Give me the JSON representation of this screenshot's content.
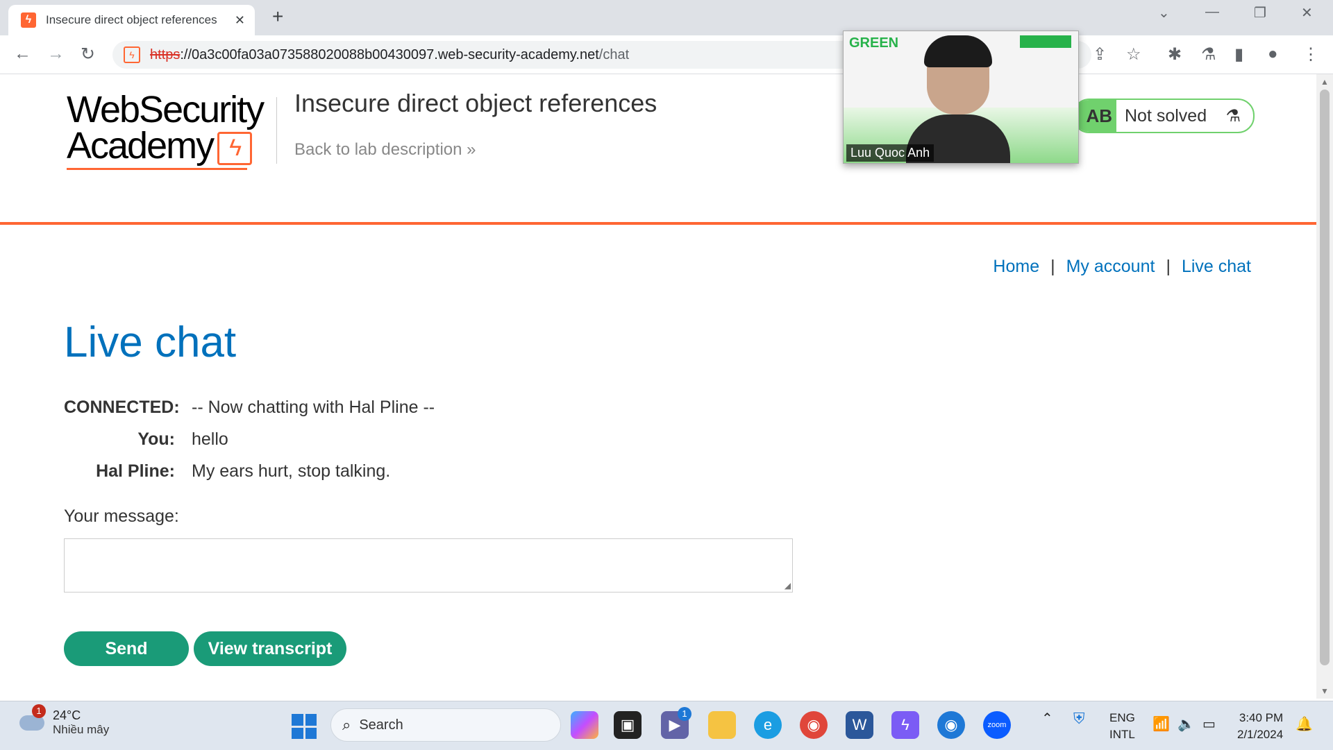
{
  "browser": {
    "tab_title": "Insecure direct object references",
    "tab_close": "✕",
    "new_tab": "+",
    "url_scheme": "https",
    "url_host": "://0a3c00fa03a073588020088b00430097.web-security-academy.net",
    "url_path": "/chat",
    "window_controls": {
      "dropdown": "⌄",
      "minimize": "—",
      "restore": "❐",
      "close": "✕"
    },
    "icons": [
      "back-icon",
      "forward-icon",
      "reload-icon",
      "share-icon",
      "star-icon",
      "extensions-icon",
      "labs-icon",
      "sidepanel-icon",
      "profile-icon",
      "menu-icon"
    ]
  },
  "header": {
    "logo_line1": "WebSecurity",
    "logo_line2": "Academy",
    "lab_title": "Insecure direct object references",
    "back_link": "Back to lab description",
    "back_chevron": "»",
    "status_prefix": "AB",
    "status_text": "Not solved"
  },
  "video": {
    "brand": "GREEN",
    "participant_name": "Luu Quoc Anh"
  },
  "nav": {
    "items": [
      {
        "label": "Home"
      },
      {
        "label": "My account"
      },
      {
        "label": "Live chat"
      }
    ],
    "separator": "|"
  },
  "main": {
    "heading": "Live chat",
    "messages": [
      {
        "who": "CONNECTED:",
        "text": "-- Now chatting with Hal Pline --"
      },
      {
        "who": "You:",
        "text": "hello"
      },
      {
        "who": "Hal Pline:",
        "text": "My ears hurt, stop talking."
      }
    ],
    "message_label": "Your message:",
    "message_value": "",
    "send_label": "Send",
    "transcript_label": "View transcript"
  },
  "taskbar": {
    "weather_temp": "24°C",
    "weather_desc": "Nhiều mây",
    "weather_badge": "1",
    "search_label": "Search",
    "teams_badge": "1",
    "lang1": "ENG",
    "lang2": "INTL",
    "time": "3:40 PM",
    "date": "2/1/2024",
    "colors": {
      "accent": "#1e78d6",
      "brand_orange": "#ff6633",
      "link": "#0071bc",
      "button": "#1a9b78",
      "status_green": "#70d16d"
    }
  }
}
